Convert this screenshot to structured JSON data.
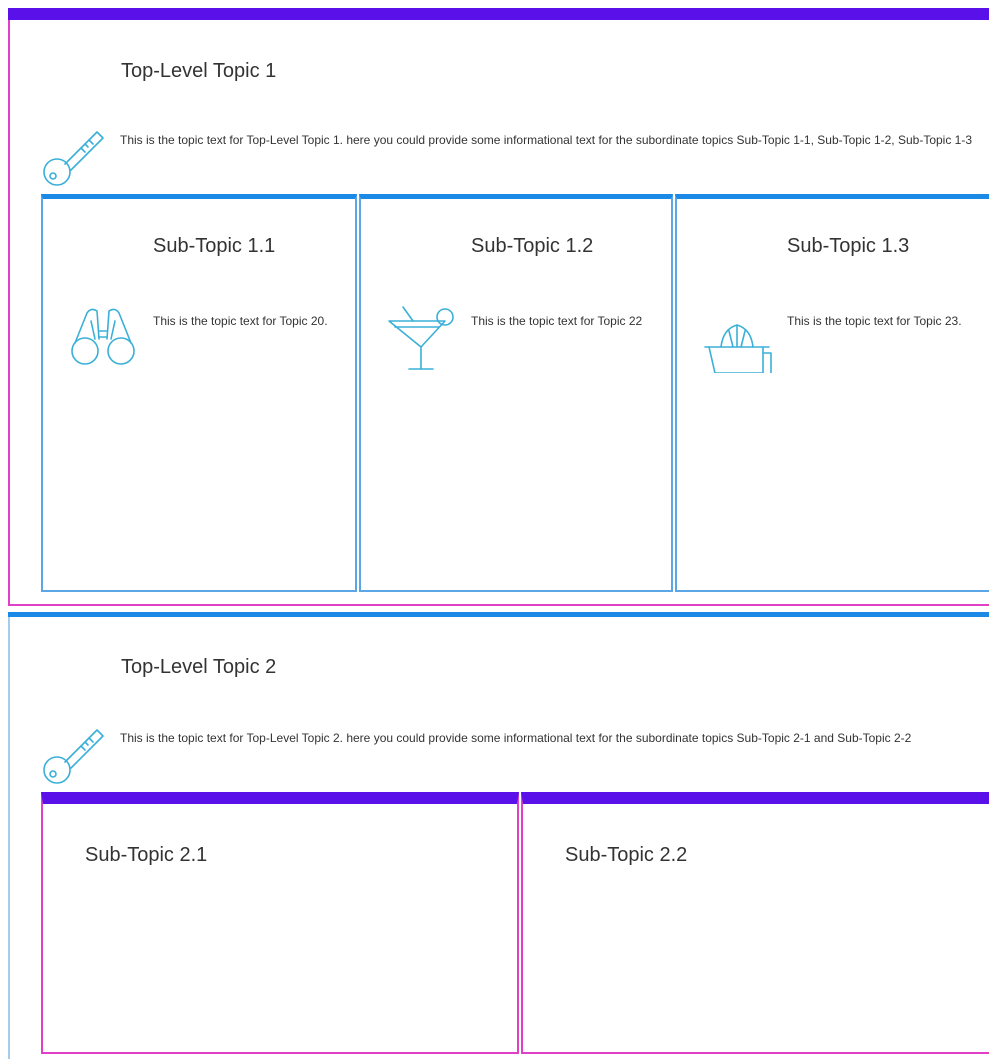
{
  "topics": [
    {
      "title": "Top-Level Topic 1",
      "icon": "key-icon",
      "text": "This is the topic text for Top-Level Topic 1. here you could provide some informational text for the subordinate topics Sub-Topic 1-1, Sub-Topic 1-2, Sub-Topic 1-3",
      "subtopics": [
        {
          "title": "Sub-Topic 1.1",
          "icon": "binoculars-icon",
          "text": "This is the topic text for Topic 20."
        },
        {
          "title": "Sub-Topic 1.2",
          "icon": "cocktail-icon",
          "text": "This is the topic text for Topic 22"
        },
        {
          "title": "Sub-Topic 1.3",
          "icon": "juicer-icon",
          "text": "This is the topic text for Topic 23."
        }
      ]
    },
    {
      "title": "Top-Level Topic 2",
      "icon": "key-icon",
      "text": "This is the topic text for Top-Level Topic 2. here you could provide some informational text for the subordinate topics Sub-Topic 2-1 and Sub-Topic 2-2",
      "subtopics": [
        {
          "title": "Sub-Topic 2.1"
        },
        {
          "title": "Sub-Topic 2.2"
        }
      ]
    }
  ],
  "colors": {
    "purple_bar": "#5a10e8",
    "magenta_border": "#e040c8",
    "blue_bar": "#1a8ae6",
    "light_blue_border": "#5aa6e6",
    "icon_color": "#3ab0d8"
  }
}
